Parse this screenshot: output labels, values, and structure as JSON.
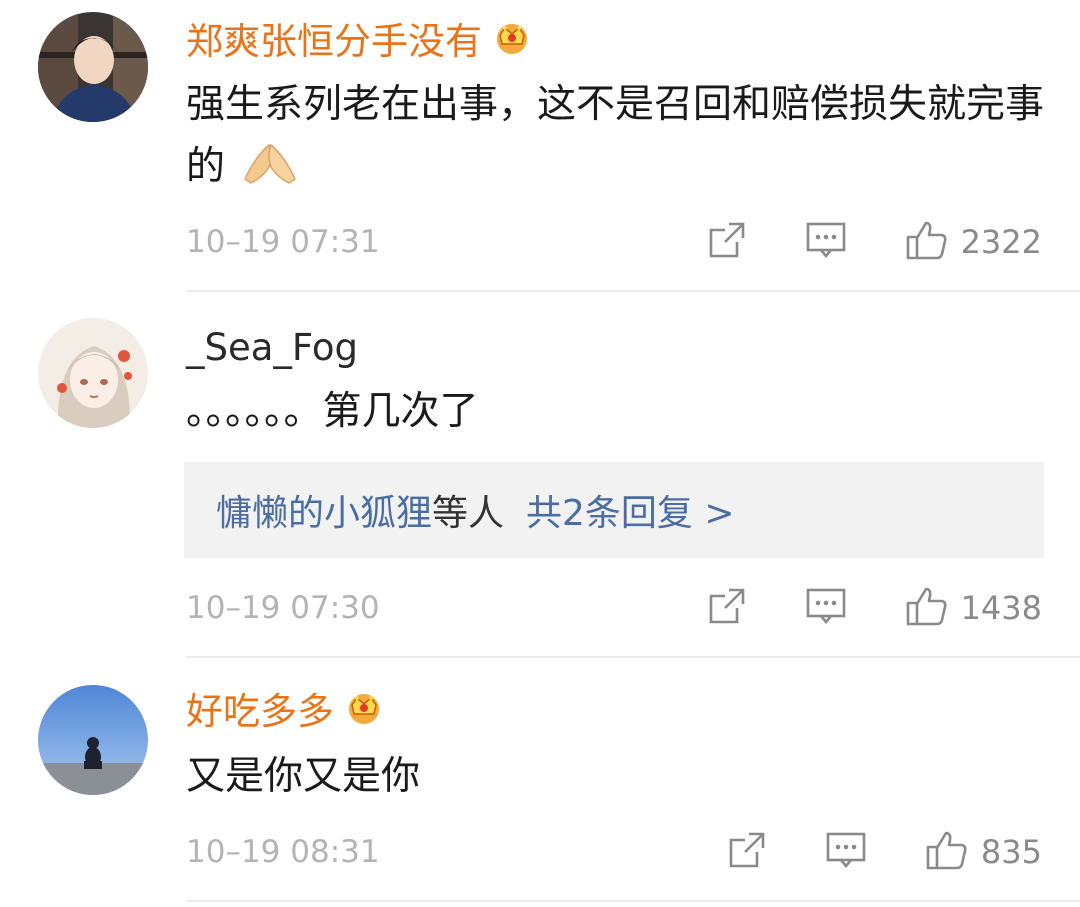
{
  "comments": [
    {
      "username": "郑爽张恒分手没有",
      "vip": true,
      "text": "强生系列老在出事，这不是召回和赔偿损失就完事的",
      "emoji_icon": "praying-hands-icon",
      "time": "10–19 07:31",
      "likes": "2322"
    },
    {
      "username": "_Sea_Fog",
      "vip": false,
      "text": "。。。。。。第几次了",
      "reply": {
        "user": "慵懒的小狐狸",
        "suffix": "等人",
        "count": "共2条回复 >"
      },
      "time": "10–19 07:30",
      "likes": "1438"
    },
    {
      "username": "好吃多多",
      "vip": true,
      "text": "又是你又是你",
      "time": "10–19 08:31",
      "likes": "835"
    }
  ],
  "colors": {
    "vip_name": "#eb7317",
    "link_blue": "#4a6ea3",
    "meta_gray": "#b4b4b4",
    "reply_bg": "#f2f2f2"
  }
}
